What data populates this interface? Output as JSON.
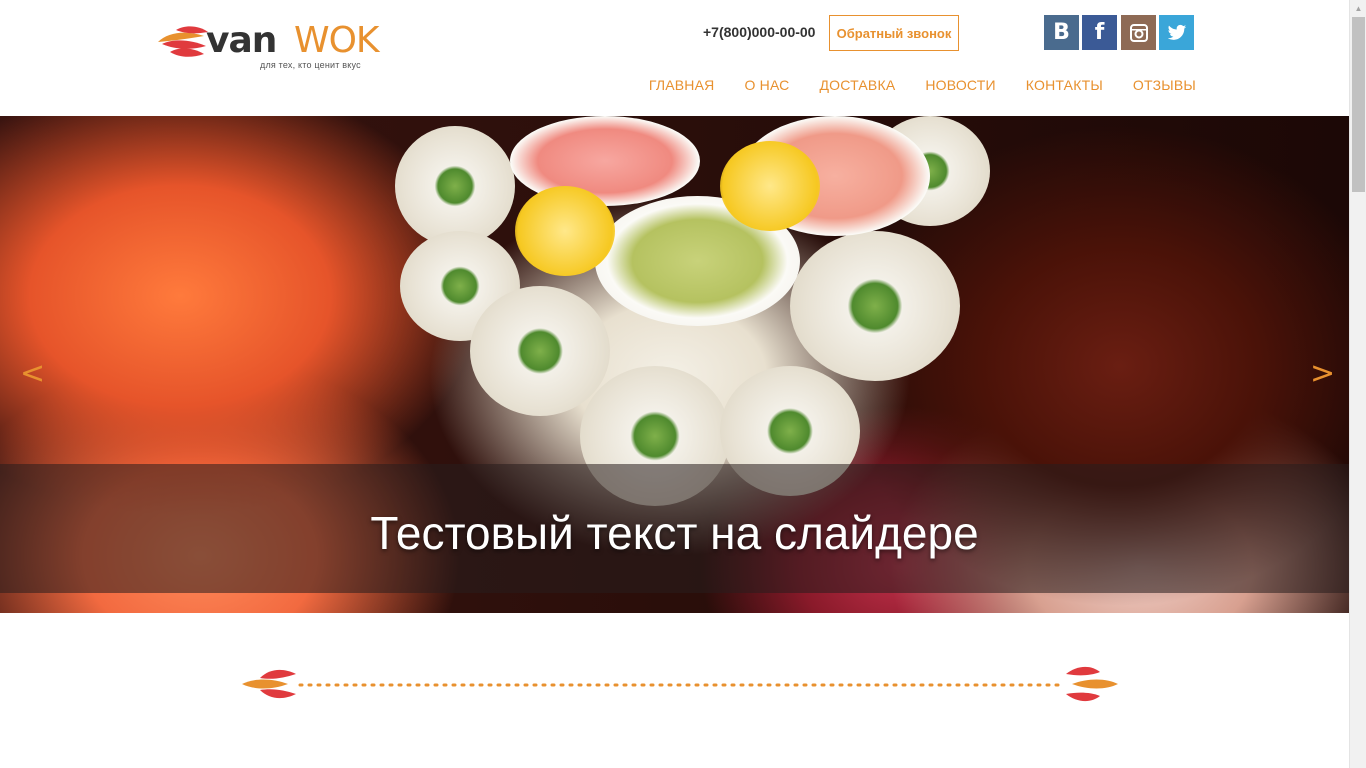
{
  "header": {
    "logo": {
      "van": "van",
      "wok": "WOK",
      "tagline": "для тех, кто ценит вкус"
    },
    "phone": "+7(800)000-00-00",
    "callback_label": "Обратный звонок",
    "social": [
      {
        "name": "vk",
        "glyph": "B",
        "color": "#4a6b8e"
      },
      {
        "name": "facebook",
        "glyph": "f",
        "color": "#3b5a96"
      },
      {
        "name": "instagram",
        "glyph": "",
        "color": "#8e6a55"
      },
      {
        "name": "twitter",
        "glyph": "",
        "color": "#3aa6d9"
      }
    ],
    "nav": [
      "ГЛАВНАЯ",
      "О НАС",
      "ДОСТАВКА",
      "НОВОСТИ",
      "КОНТАКТЫ",
      "ОТЗЫВЫ"
    ]
  },
  "slider": {
    "caption": "Тестовый текст на слайдере",
    "prev": "<",
    "next": ">"
  },
  "colors": {
    "accent": "#e8912f",
    "red": "#e03a3e"
  }
}
